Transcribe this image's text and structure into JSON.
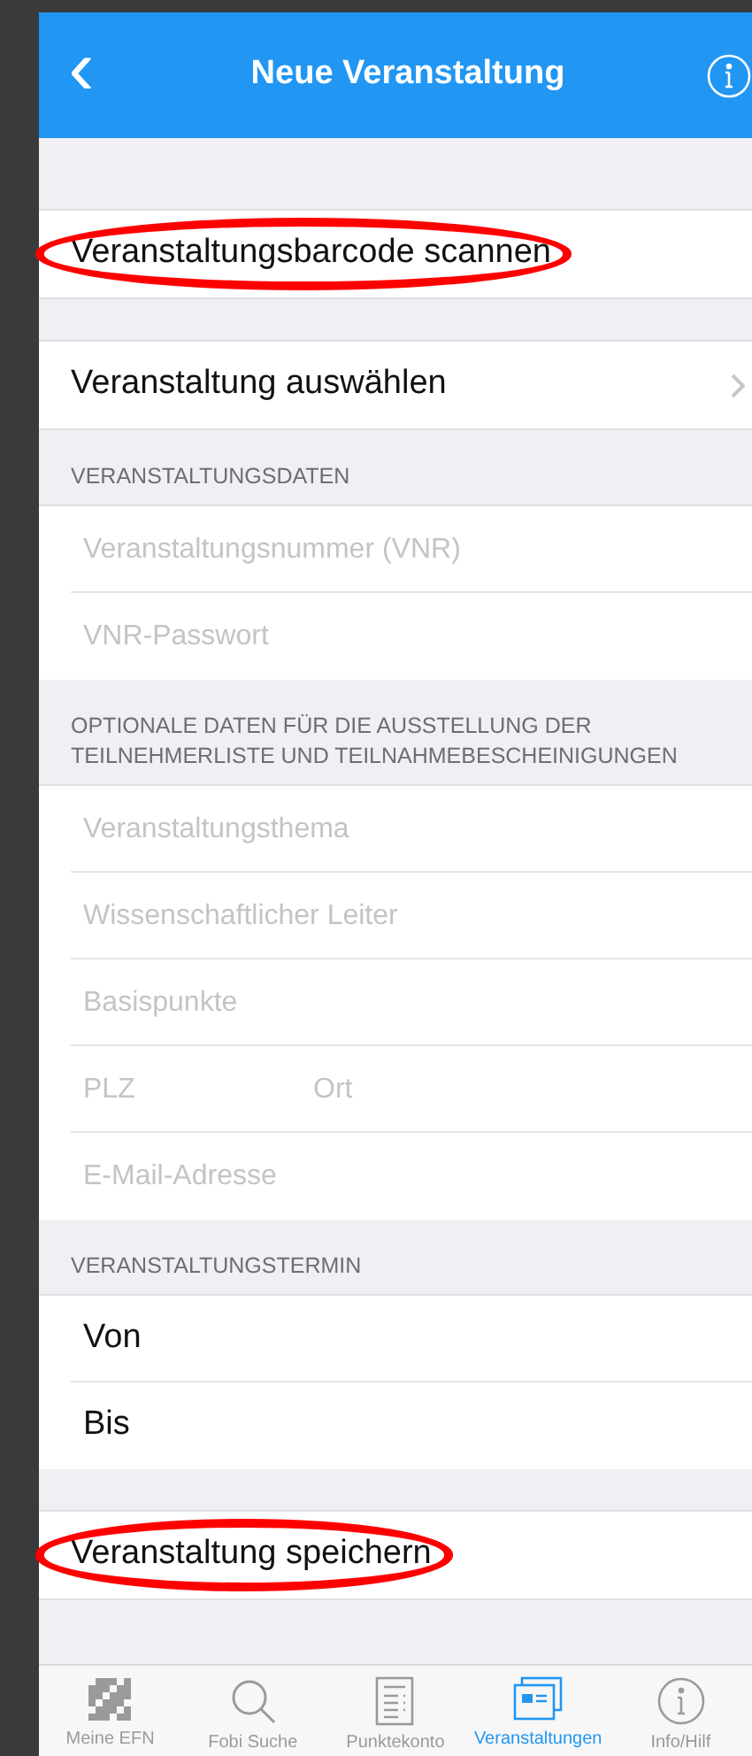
{
  "nav_bar": {
    "back": "‹",
    "title": "Neue Veranstaltung"
  },
  "sections": [
    {
      "rows": [
        {
          "kind": "action",
          "label": "Veranstaltungsbarcode scannen",
          "highlighted": true
        }
      ]
    },
    {
      "rows": [
        {
          "kind": "link",
          "label": "Veranstaltung auswählen",
          "highlighted": false
        }
      ]
    },
    {
      "header": "VERANSTALTUNGSDATEN",
      "rows": [
        {
          "kind": "field",
          "placeholder": "Veranstaltungsnummer (VNR)"
        },
        {
          "kind": "field",
          "placeholder": "VNR-Passwort"
        }
      ]
    },
    {
      "header": "OPTIONALE DATEN FÜR DIE AUSSTELLUNG DER TEILNEHMERLISTE UND TEILNAHMEBESCHEINIGUNGEN",
      "rows": [
        {
          "kind": "field",
          "placeholder": "Veranstaltungsthema"
        },
        {
          "kind": "field",
          "placeholder": "Wissenschaftlicher Leiter"
        },
        {
          "kind": "field",
          "placeholder": "Basispunkte"
        },
        {
          "kind": "pair",
          "placeholders": [
            "PLZ",
            "Ort"
          ]
        },
        {
          "kind": "field",
          "placeholder": "E-Mail-Adresse"
        }
      ]
    },
    {
      "header": "VERANSTALTUNGSTERMIN",
      "rows": [
        {
          "kind": "date",
          "label": "Von"
        },
        {
          "kind": "date",
          "label": "Bis"
        }
      ]
    },
    {
      "rows": [
        {
          "kind": "action",
          "label": "Veranstaltung speichern",
          "highlighted": true
        }
      ]
    }
  ],
  "tab_bar": [
    {
      "label": "Meine EFN",
      "selected": false
    },
    {
      "label": "Fobi Suche",
      "selected": false
    },
    {
      "label": "Punktekonto",
      "selected": false
    },
    {
      "label": "Veranstaltungen",
      "selected": true
    },
    {
      "label": "Info/Hilf",
      "selected": false
    }
  ]
}
